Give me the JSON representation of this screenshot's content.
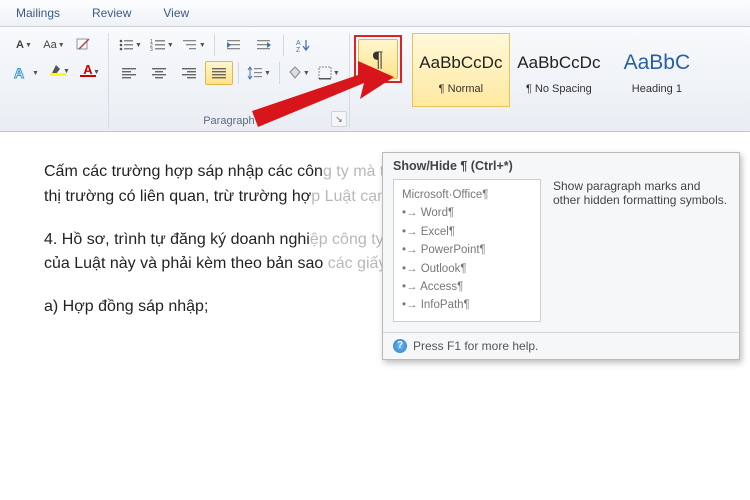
{
  "tabs": {
    "mailings": "Mailings",
    "review": "Review",
    "view": "View"
  },
  "ribbon": {
    "paragraph_label": "Paragraph",
    "pilcrow_glyph": "¶"
  },
  "styles": {
    "sample": "AaBbCcDc",
    "sample_h": "AaBbC",
    "normal": "¶ Normal",
    "nospacing": "¶ No Spacing",
    "heading1": "Heading 1"
  },
  "tooltip": {
    "title": "Show/Hide ¶ (Ctrl+*)",
    "desc": "Show paragraph marks and other hidden formatting symbols.",
    "sample_title": "Microsoft·Office¶",
    "items": [
      "Word¶",
      "Excel¶",
      "PowerPoint¶",
      "Outlook¶",
      "Access¶",
      "InfoPath¶"
    ],
    "footer": "Press F1 for more help."
  },
  "doc": {
    "p1a": "Cấm các trường hợp sáp nhập các côn",
    "p1a_faded": "g ty mà theo đó công ty nhận sáp nhập có",
    "p1b": "thị trường có liên quan, trừ trường hợ",
    "p1b_faded": "p Luật cạnh tranh không cấm hạn chế.",
    "p2a": "4. Hồ sơ, trình tự đăng ký doanh nghi",
    "p2a_faded": "ệp công ty nhận sáp nhập thực hiện theo c",
    "p2b": "của Luật này và phải kèm theo bản sao",
    "p2b_faded": " các giấy tờ sau đây:",
    "p3": "a) Hợp đồng sáp nhập;"
  }
}
